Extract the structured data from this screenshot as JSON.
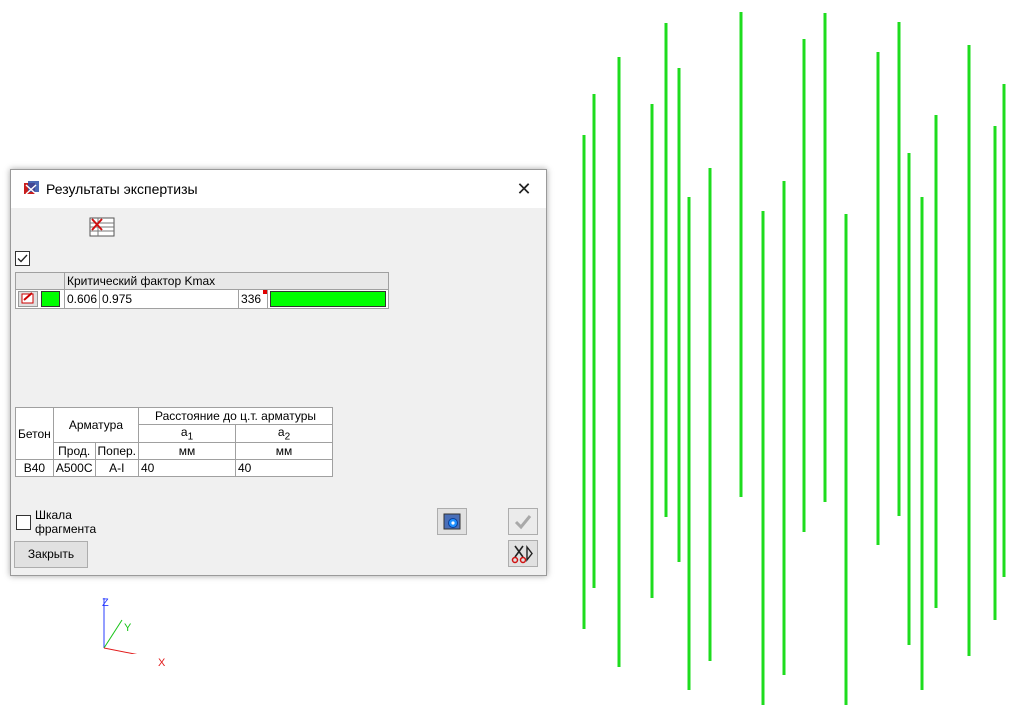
{
  "dialog": {
    "title": "Результаты экспертизы",
    "close_glyph": "✕",
    "show_checkbox_checked": true
  },
  "kmax_table": {
    "header": "Критический фактор Kmax",
    "row": {
      "min": "0.606",
      "max": "0.975",
      "count": "336",
      "color": "#00ff00"
    }
  },
  "geometry_table": {
    "headers": {
      "concrete": "Бетон",
      "rebar": "Арматура",
      "distance": "Расстояние до ц.т. арматуры",
      "a1": "a",
      "a1_sub": "1",
      "a2": "a",
      "a2_sub": "2",
      "long": "Прод.",
      "transverse": "Попер.",
      "unit1": "мм",
      "unit2": "мм"
    },
    "row": {
      "concrete": "B40",
      "long": "A500C",
      "transverse": "A-I",
      "a1": "40",
      "a2": "40"
    }
  },
  "scale_checkbox": {
    "label_line1": "Шкала",
    "label_line2": "фрагмента",
    "checked": false
  },
  "buttons": {
    "close": "Закрыть",
    "settings_icon": "settings-icon",
    "apply_icon": "check-icon",
    "cut_icon": "scissors-icon"
  },
  "axes": {
    "z": "Z",
    "y": "Y",
    "x": "X"
  },
  "colors": {
    "bars": "#1edc1e",
    "accent": "#00ff00"
  }
}
